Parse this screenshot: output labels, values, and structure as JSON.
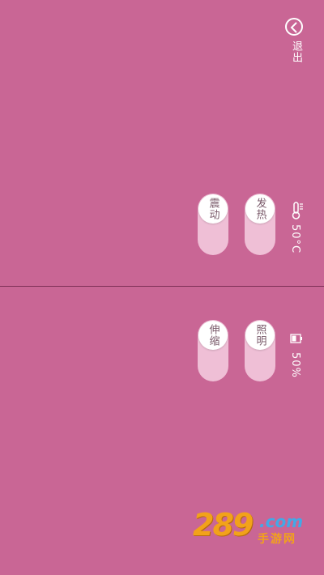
{
  "header": {
    "exit_label": "退出"
  },
  "top_panel": {
    "temperature_value": "50°C",
    "toggles": [
      {
        "label": "震动"
      },
      {
        "label": "发热"
      }
    ]
  },
  "bottom_panel": {
    "battery_value": "50%",
    "toggles": [
      {
        "label": "伸缩"
      },
      {
        "label": "照明"
      }
    ]
  },
  "watermark": {
    "number": "289",
    "suffix": ".com",
    "cn": "手游网"
  },
  "colors": {
    "background": "#c96695",
    "toggle_track": "#efbfd6",
    "knob": "#ffffff"
  }
}
